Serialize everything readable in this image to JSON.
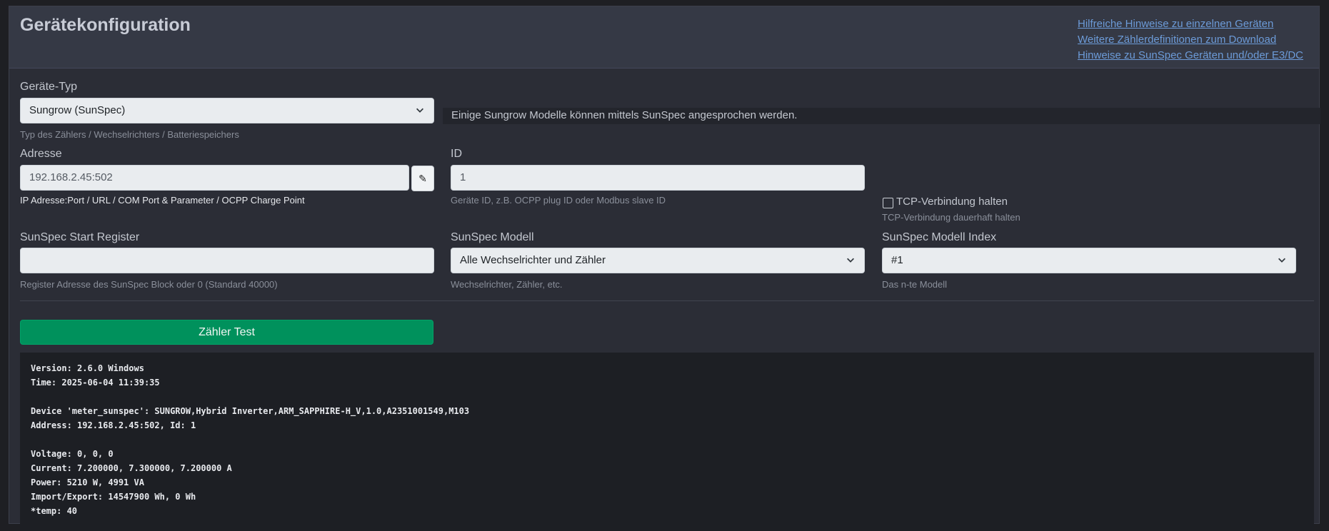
{
  "header": {
    "title": "Gerätekonfiguration",
    "links": [
      "Hilfreiche Hinweise zu einzelnen Geräten",
      "Weitere Zählerdefinitionen zum Download",
      "Hinweise zu SunSpec Geräten und/oder E3/DC"
    ]
  },
  "device_type": {
    "label": "Geräte-Typ",
    "value": "Sungrow (SunSpec)",
    "hint": "Typ des Zählers / Wechselrichters / Batteriespeichers",
    "info": "Einige Sungrow Modelle können mittels SunSpec angesprochen werden."
  },
  "address": {
    "label": "Adresse",
    "value": "192.168.2.45:502",
    "hint": "IP Adresse:Port / URL / COM Port & Parameter / OCPP Charge Point",
    "edit_icon": "✎"
  },
  "id": {
    "label": "ID",
    "value": "1",
    "hint": "Geräte ID, z.B. OCPP plug ID oder Modbus slave ID"
  },
  "tcp": {
    "label": "TCP-Verbindung halten",
    "hint": "TCP-Verbindung dauerhaft halten",
    "checked": false
  },
  "sunspec_start": {
    "label": "SunSpec Start Register",
    "value": "",
    "hint": "Register Adresse des SunSpec Block oder 0 (Standard 40000)"
  },
  "sunspec_model": {
    "label": "SunSpec Modell",
    "value": "Alle Wechselrichter und Zähler",
    "hint": "Wechselrichter, Zähler, etc."
  },
  "sunspec_index": {
    "label": "SunSpec Modell Index",
    "value": "#1",
    "hint": "Das n-te Modell"
  },
  "test_button": {
    "label": "Zähler Test"
  },
  "console": {
    "lines": [
      "Version: 2.6.0 Windows",
      "Time: 2025-06-04 11:39:35",
      "",
      "Device 'meter_sunspec': SUNGROW,Hybrid Inverter,ARM_SAPPHIRE-H_V,1.0,A2351001549,M103",
      "Address: 192.168.2.45:502, Id: 1",
      "",
      "Voltage: 0, 0, 0",
      "Current: 7.200000, 7.300000, 7.200000 A",
      "Power: 5210 W, 4991 VA",
      "Import/Export: 14547900 Wh, 0 Wh",
      "*temp: 40"
    ]
  },
  "icons": {
    "dropdown": "chevron-down-icon",
    "edit": "pencil-icon"
  }
}
